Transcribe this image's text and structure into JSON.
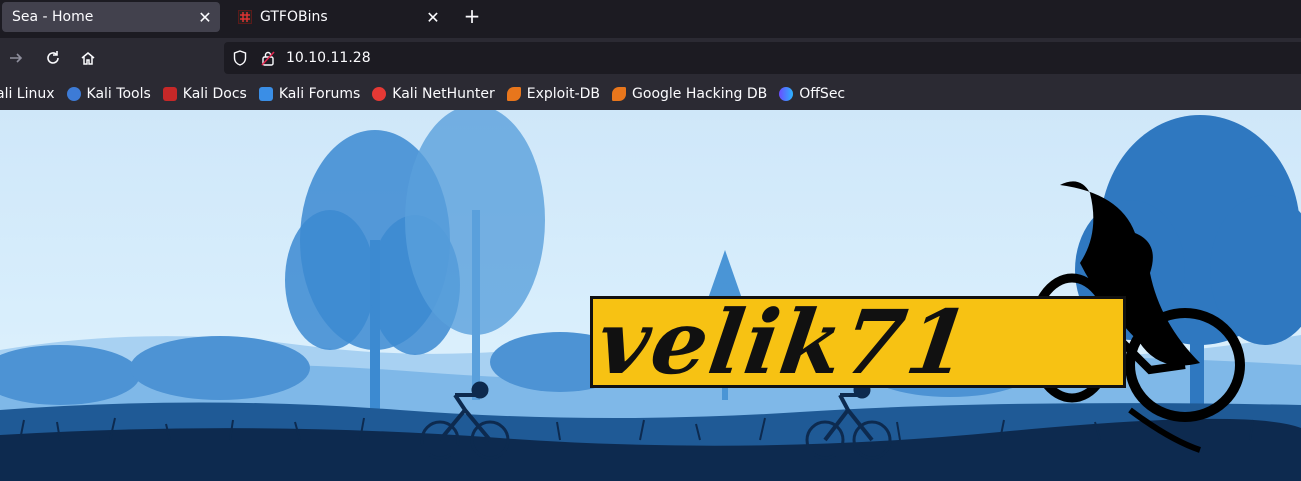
{
  "browser": {
    "tabs": [
      {
        "label": "Sea - Home",
        "active": true
      },
      {
        "label": "GTFOBins",
        "active": false
      }
    ],
    "url": "10.10.11.28",
    "bookmarks": [
      {
        "label": "ali Linux",
        "icon": "kali-linux-icon"
      },
      {
        "label": "Kali Tools",
        "icon": "kali-tools-icon"
      },
      {
        "label": "Kali Docs",
        "icon": "kali-docs-icon"
      },
      {
        "label": "Kali Forums",
        "icon": "kali-forums-icon"
      },
      {
        "label": "Kali NetHunter",
        "icon": "kali-nethunter-icon"
      },
      {
        "label": "Exploit-DB",
        "icon": "exploit-db-icon"
      },
      {
        "label": "Google Hacking DB",
        "icon": "ghdb-icon"
      },
      {
        "label": "OffSec",
        "icon": "offsec-icon"
      }
    ]
  },
  "page": {
    "logo_text": "velik71"
  },
  "colors": {
    "sky": "#cfe7f9",
    "logo_bg": "#f7c213",
    "tree_dark": "#2f78c0",
    "ground": "#0d2a4f"
  }
}
